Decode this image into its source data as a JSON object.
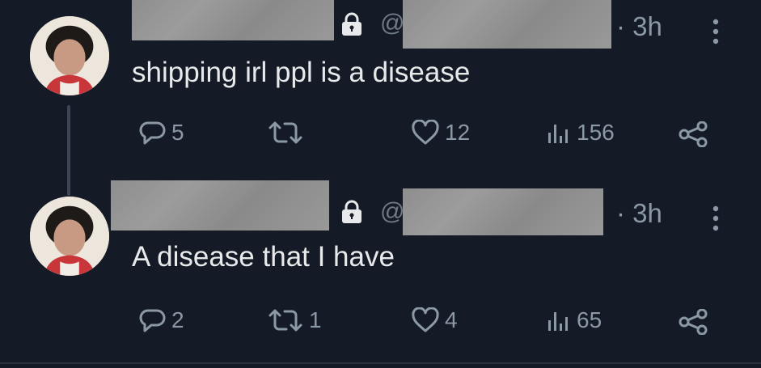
{
  "tweets": [
    {
      "handle_prefix": "@",
      "time": "· 3h",
      "text": "shipping irl ppl is a disease",
      "replies": "5",
      "retweets": "",
      "likes": "12",
      "views": "156"
    },
    {
      "handle_prefix": "@",
      "time": "· 3h",
      "text": "A disease that I have",
      "replies": "2",
      "retweets": "1",
      "likes": "4",
      "views": "65"
    }
  ],
  "colors": {
    "background": "#151b26",
    "text": "#e7e9ea",
    "muted": "#8b98a5"
  },
  "icons": [
    "lock-icon",
    "more-icon",
    "reply-icon",
    "retweet-icon",
    "like-icon",
    "views-icon",
    "share-icon"
  ]
}
